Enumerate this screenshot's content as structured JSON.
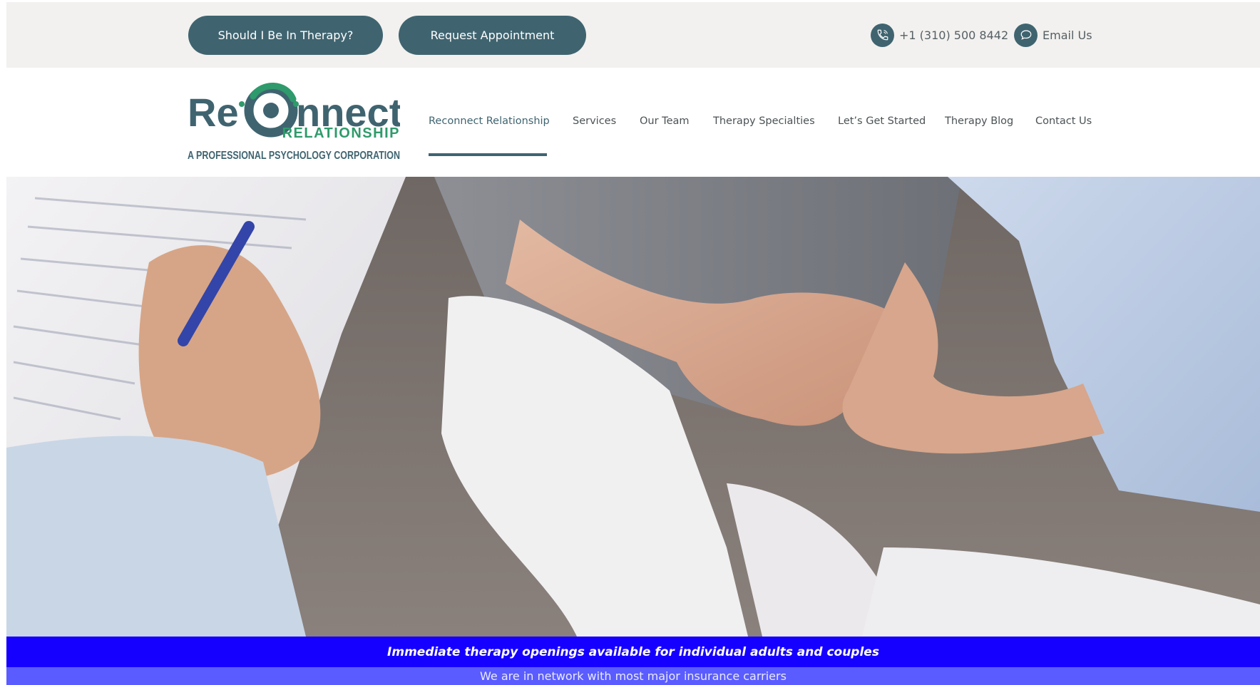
{
  "topbar": {
    "therapy_button": "Should I Be In Therapy?",
    "appointment_button": "Request Appointment",
    "phone": "+1 (310) 500 8442",
    "email": "Email Us"
  },
  "logo": {
    "wordmark_prefix": "Re",
    "wordmark_suffix": "nnect",
    "subtitle": "RELATIONSHIP",
    "tagline": "A PROFESSIONAL PSYCHOLOGY CORPORATION"
  },
  "nav": {
    "items": [
      {
        "label": "Reconnect Relationship",
        "active": true
      },
      {
        "label": "Services"
      },
      {
        "label": "Our Team"
      },
      {
        "label": "Therapy Specialties"
      },
      {
        "label": "Let’s Get Started"
      },
      {
        "label": "Therapy Blog"
      },
      {
        "label": "Contact Us"
      }
    ]
  },
  "banner": {
    "headline": "Immediate therapy openings available for individual adults and couples",
    "subline": "We are in network with most major insurance carriers"
  },
  "colors": {
    "brand_teal": "#3f6470",
    "brand_green": "#2f9a6b",
    "banner_blue": "#1500ff",
    "banner_light_blue": "#5a5cff",
    "topbar_bg": "#f2f1ef"
  },
  "icons": [
    "phone-icon",
    "chat-bubble-icon"
  ]
}
